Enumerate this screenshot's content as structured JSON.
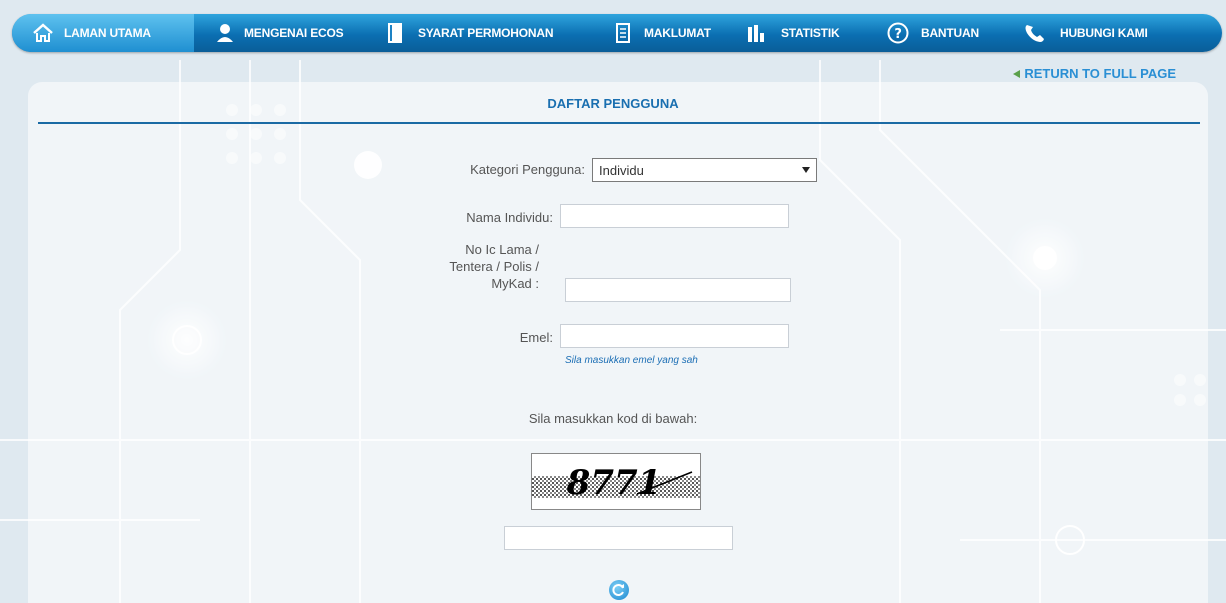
{
  "nav": {
    "items": [
      {
        "label": "LAMAN UTAMA",
        "icon": "home-icon"
      },
      {
        "label": "MENGENAI ECOS",
        "icon": "user-icon"
      },
      {
        "label": "SYARAT PERMOHONAN",
        "icon": "book-icon"
      },
      {
        "label": "MAKLUMAT",
        "icon": "document-icon"
      },
      {
        "label": "STATISTIK",
        "icon": "bar-chart-icon"
      },
      {
        "label": "BANTUAN",
        "icon": "help-icon"
      },
      {
        "label": "HUBUNGI KAMI",
        "icon": "phone-icon"
      }
    ]
  },
  "return_link": "RETURN TO FULL PAGE",
  "page_title": "DAFTAR PENGGUNA",
  "form": {
    "kategori_label": "Kategori Pengguna:",
    "kategori_value": "Individu",
    "nama_label": "Nama Individu:",
    "nama_value": "",
    "ic_label_line1": "No Ic Lama /",
    "ic_label_line2": "Tentera / Polis /",
    "ic_label_line3": "MyKad :",
    "ic_value": "",
    "emel_label": "Emel:",
    "emel_value": "",
    "emel_hint": "Sila masukkan emel yang sah",
    "captcha_prompt": "Sila masukkan kod di bawah:",
    "captcha_text": "8771",
    "captcha_value": ""
  },
  "colors": {
    "nav_blue": "#0b6fb2",
    "title_blue": "#1a6fb0",
    "link_blue": "#2a8fd4"
  }
}
